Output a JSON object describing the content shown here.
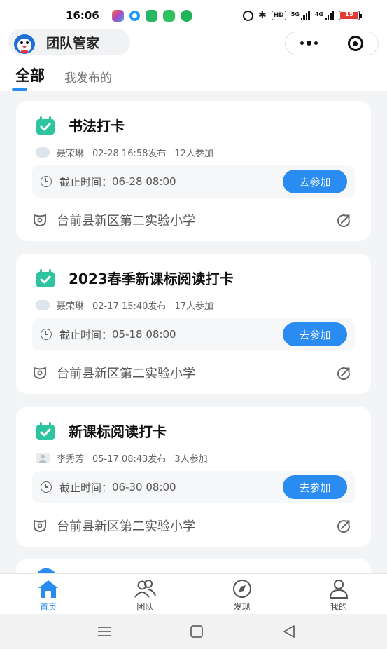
{
  "status_bar": {
    "time": "16:06",
    "hd_label": "HD",
    "signal_1": "5G",
    "signal_2": "4G",
    "battery": "19",
    "colors": {
      "notif_1": "#ff7043",
      "notif_2": "#2196f3",
      "notif_3": "#29b765",
      "notif_4": "#2fc05f",
      "notif_5": "#21b35a",
      "battery_low": "#e53935"
    }
  },
  "app_bar": {
    "title": "团队管家",
    "more_icon": "more-dots-icon",
    "close_icon": "target-close-icon"
  },
  "tabs": [
    {
      "label": "全部",
      "active": true
    },
    {
      "label": "我发布的",
      "active": false
    }
  ],
  "tasks": [
    {
      "title": "书法打卡",
      "author": "聂荣琳",
      "published": "02-28 16:58发布",
      "participants": "12人参加",
      "deadline_label": "截止时间：",
      "deadline": "06-28 08:00",
      "action": "去参加",
      "school": "台前县新区第二实验小学"
    },
    {
      "title": "2023春季新课标阅读打卡",
      "author": "聂荣琳",
      "published": "02-17 15:40发布",
      "participants": "17人参加",
      "deadline_label": "截止时间：",
      "deadline": "05-18 08:00",
      "action": "去参加",
      "school": "台前县新区第二实验小学"
    },
    {
      "title": "新课标阅读打卡",
      "author": "李秀芳",
      "published": "05-17 08:43发布",
      "participants": "3人参加",
      "deadline_label": "截止时间：",
      "deadline": "06-30 08:00",
      "action": "去参加",
      "school": "台前县新区第二实验小学"
    }
  ],
  "bottom_nav": [
    {
      "label": "首页",
      "icon": "home-icon",
      "active": true
    },
    {
      "label": "团队",
      "icon": "team-icon",
      "active": false
    },
    {
      "label": "发现",
      "icon": "compass-icon",
      "active": false
    },
    {
      "label": "我的",
      "icon": "user-icon",
      "active": false
    }
  ],
  "theme": {
    "accent": "#2a8cf0",
    "checkin_green": "#2ec4a0",
    "background": "#f3f4f6"
  }
}
